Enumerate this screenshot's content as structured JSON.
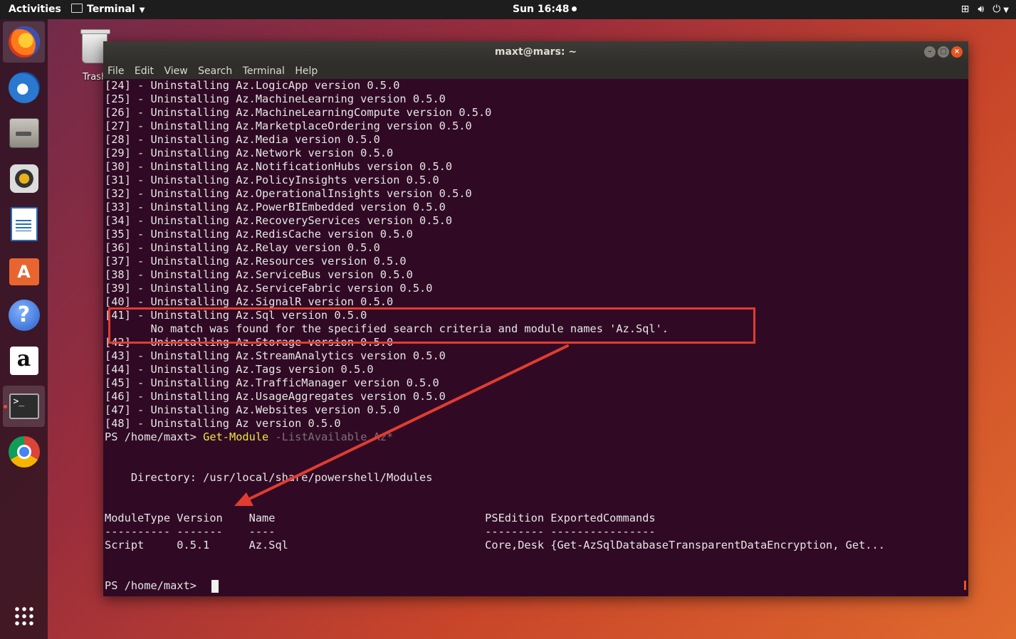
{
  "topbar": {
    "activities": "Activities",
    "app_name": "Terminal",
    "clock": "Sun 16:48"
  },
  "desktop": {
    "trash_label": "Trash"
  },
  "dock": {
    "items": [
      "firefox-icon",
      "thunderbird-icon",
      "files-icon",
      "rhythmbox-icon",
      "writer-icon",
      "software-icon",
      "help-icon",
      "amazon-icon",
      "terminal-icon",
      "chrome-icon",
      "show-apps-icon"
    ]
  },
  "window": {
    "title": "maxt@mars: ~",
    "menu": [
      "File",
      "Edit",
      "View",
      "Search",
      "Terminal",
      "Help"
    ]
  },
  "terminal": {
    "lines": [
      "[24] - Uninstalling Az.LogicApp version 0.5.0",
      "[25] - Uninstalling Az.MachineLearning version 0.5.0",
      "[26] - Uninstalling Az.MachineLearningCompute version 0.5.0",
      "[27] - Uninstalling Az.MarketplaceOrdering version 0.5.0",
      "[28] - Uninstalling Az.Media version 0.5.0",
      "[29] - Uninstalling Az.Network version 0.5.0",
      "[30] - Uninstalling Az.NotificationHubs version 0.5.0",
      "[31] - Uninstalling Az.PolicyInsights version 0.5.0",
      "[32] - Uninstalling Az.OperationalInsights version 0.5.0",
      "[33] - Uninstalling Az.PowerBIEmbedded version 0.5.0",
      "[34] - Uninstalling Az.RecoveryServices version 0.5.0",
      "[35] - Uninstalling Az.RedisCache version 0.5.0",
      "[36] - Uninstalling Az.Relay version 0.5.0",
      "[37] - Uninstalling Az.Resources version 0.5.0",
      "[38] - Uninstalling Az.ServiceBus version 0.5.0",
      "[39] - Uninstalling Az.ServiceFabric version 0.5.0",
      "[40] - Uninstalling Az.SignalR version 0.5.0",
      "[41] - Uninstalling Az.Sql version 0.5.0",
      "       No match was found for the specified search criteria and module names 'Az.Sql'.",
      "[42] - Uninstalling Az.Storage version 0.5.0",
      "[43] - Uninstalling Az.StreamAnalytics version 0.5.0",
      "[44] - Uninstalling Az.Tags version 0.5.0",
      "[45] - Uninstalling Az.TrafficManager version 0.5.0",
      "[46] - Uninstalling Az.UsageAggregates version 0.5.0",
      "[47] - Uninstalling Az.Websites version 0.5.0",
      "[48] - Uninstalling Az version 0.5.0"
    ],
    "prompt": "PS /home/maxt> ",
    "command": {
      "name": "Get-Module",
      "param": "-ListAvailable",
      "arg": "Az*"
    },
    "directory_line": "    Directory: /usr/local/share/powershell/Modules",
    "table_header": "ModuleType Version    Name                                PSEdition ExportedCommands",
    "table_rule": "---------- -------    ----                                --------- ----------------",
    "table_row": "Script     0.5.1      Az.Sql                              Core,Desk {Get-AzSqlDatabaseTransparentDataEncryption, Get...",
    "final_prompt": "PS /home/maxt> "
  },
  "colors": {
    "terminal_bg": "#300a24",
    "accent": "#e95420",
    "annotation": "#e03c31",
    "command": "#e8e83a",
    "param": "#7a6f77"
  }
}
